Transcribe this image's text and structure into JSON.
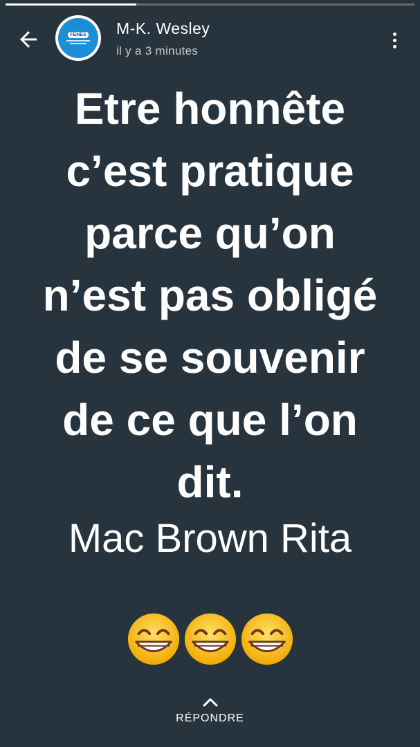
{
  "status_progress": 0.32,
  "header": {
    "author_name": "M-K. Wesley",
    "timestamp": "il y a 3 minutes",
    "avatar": {
      "badge": "FENES",
      "icon": "avatar-logo-icon"
    },
    "back_icon": "arrow-left-icon",
    "menu_icon": "more-vert-icon"
  },
  "status": {
    "quote_lines": [
      "Etre honnête",
      "c’est pratique",
      "parce qu’on",
      "n’est pas obligé",
      "de se souvenir",
      "de ce que l’on",
      "dit."
    ],
    "author": "Mac Brown Rita",
    "emojis": [
      "grinning-face-icon",
      "grinning-face-icon",
      "grinning-face-icon"
    ]
  },
  "footer": {
    "reply_label": "RÉPONDRE",
    "reply_icon": "chevron-up-icon"
  },
  "colors": {
    "background": "#27333d",
    "text": "#ffffff",
    "timestamp": "#c7cdd2",
    "emoji_face": "#f7c12b"
  }
}
